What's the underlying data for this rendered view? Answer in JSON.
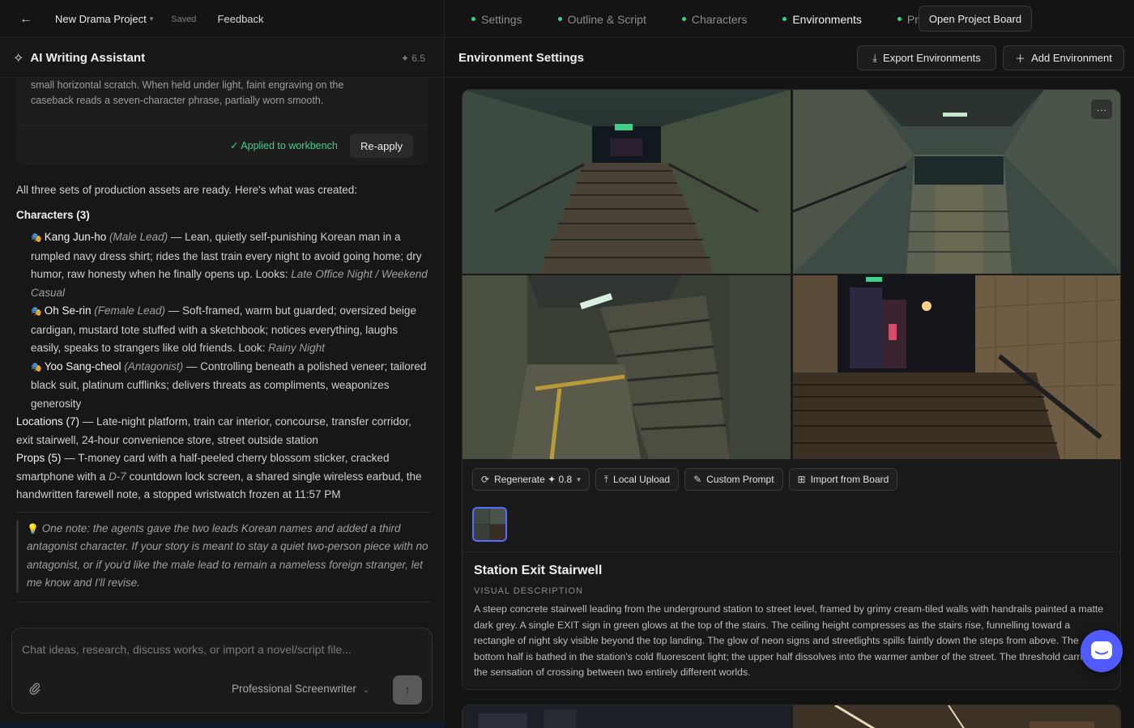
{
  "topbar": {
    "project_name": "New Drama Project",
    "saved": "Saved",
    "feedback": "Feedback",
    "tabs": [
      {
        "label": "Settings",
        "active": false
      },
      {
        "label": "Outline & Script",
        "active": false
      },
      {
        "label": "Characters",
        "active": false
      },
      {
        "label": "Environments",
        "active": true
      },
      {
        "label": "Props",
        "active": false
      }
    ],
    "open_board": "Open Project Board"
  },
  "assistant": {
    "title": "AI Writing Assistant",
    "credit": "✦ 6.5",
    "card_text_line1": "small horizontal scratch. When held under light, faint engraving on the",
    "card_text_line2": "caseback reads a seven-character phrase, partially worn smooth.",
    "applied": "✓ Applied to workbench",
    "reapply": "Re-apply",
    "intro": "All three sets of production assets are ready. Here's what was created:",
    "characters_heading": "Characters (3)",
    "characters": [
      {
        "name": "Kang Jun-ho",
        "role": "(Male Lead)",
        "desc": " — Lean, quietly self-punishing Korean man in a rumpled navy dress shirt; rides the last train every night to avoid going home; dry humor, raw honesty when he finally opens up. Looks: ",
        "looks": "Late Office Night / Weekend Casual"
      },
      {
        "name": "Oh Se-rin",
        "role": "(Female Lead)",
        "desc": " — Soft-framed, warm but guarded; oversized beige cardigan, mustard tote stuffed with a sketchbook; notices everything, laughs easily, speaks to strangers like old friends. Look: ",
        "looks": "Rainy Night"
      },
      {
        "name": "Yoo Sang-cheol",
        "role": "(Antagonist)",
        "desc": " — Controlling beneath a polished veneer; tailored black suit, platinum cufflinks; delivers threats as compliments, weaponizes generosity",
        "looks": ""
      }
    ],
    "locations_heading": "Locations (7)",
    "locations_text": " — Late-night platform, train car interior, concourse, transfer corridor, exit stairwell, 24-hour convenience store, street outside station",
    "props_heading": "Props (5)",
    "props_text_1": " — T-money card with a half-peeled cherry blossom sticker, cracked smartphone with a ",
    "props_text_em": "D-7",
    "props_text_2": " countdown lock screen, a shared single wireless earbud, the handwritten farewell note, a stopped wristwatch frozen at 11:57 PM",
    "note": "One note: the agents gave the two leads Korean names and added a third antagonist character. If your story is meant to stay a quiet two-person piece with no antagonist, or if you'd like the male lead to remain a nameless foreign stranger, let me know and I'll revise.",
    "input_placeholder": "Chat ideas, research, discuss works, or import a novel/script file...",
    "persona": "Professional Screenwriter"
  },
  "environment": {
    "title": "Environment Settings",
    "export": "Export Environments",
    "add": "Add Environment",
    "more": "···",
    "actions": {
      "regenerate": "Regenerate",
      "regenerate_cost": "✦ 0.8",
      "local_upload": "Local Upload",
      "custom_prompt": "Custom Prompt",
      "import_board": "Import from Board"
    },
    "name": "Station Exit Stairwell",
    "vd_label": "VISUAL DESCRIPTION",
    "description": "A steep concrete stairwell leading from the underground station to street level, framed by grimy cream-tiled walls with handrails painted a matte dark grey. A single EXIT sign in green glows at the top of the stairs. The ceiling height compresses as the stairs rise, funnelling toward a rectangle of night sky visible beyond the top landing. The glow of neon signs and streetlights spills faintly down the steps from above. The bottom half is bathed in the station's cold fluorescent light; the upper half dissolves into the warmer amber of the street. The threshold carries the sensation of crossing between two entirely different worlds."
  },
  "colors": {
    "accent": "#4f5bff",
    "active_dot": "#3fcf8e",
    "background": "#141414"
  }
}
